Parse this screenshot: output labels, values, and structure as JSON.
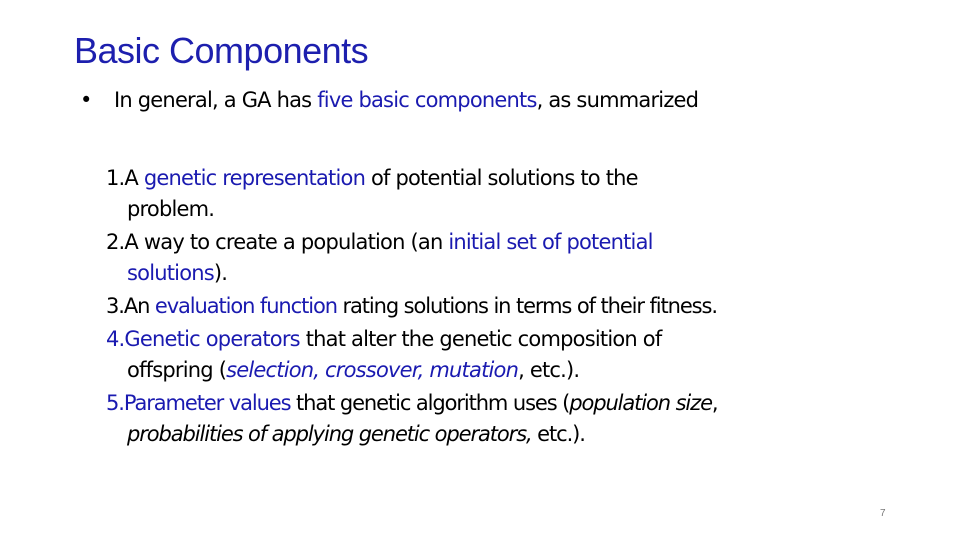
{
  "slide": {
    "title": "Basic Components",
    "bullet": {
      "marker": "•",
      "text_before": "In general, a GA has ",
      "highlight": "five basic components",
      "text_after": ", as summarized"
    },
    "items": [
      {
        "num": "1.A ",
        "highlight": "genetic representation",
        "text1": " of potential solutions to the",
        "cont": "problem."
      },
      {
        "num": "2.A way to create a population (an ",
        "highlight": "initial set of potential",
        "cont_highlight": "solutions",
        "cont_after": ")."
      },
      {
        "num": "3.An ",
        "highlight": "evaluation function",
        "text1": " rating solutions in terms of their fitness."
      },
      {
        "num_highlight": "4.Genetic operators",
        "text1": " that alter the genetic composition of",
        "cont_before": "offspring (",
        "cont_italic_blue": "selection, crossover, mutation",
        "cont_after": ", etc.)."
      },
      {
        "num_highlight": "5.Parameter values",
        "text1": " that genetic algorithm uses (",
        "italic1": "population size",
        "text2": ",",
        "cont_italic": "probabilities of applying genetic operators,",
        "cont_after": " etc.)."
      }
    ],
    "page_number": "7"
  }
}
